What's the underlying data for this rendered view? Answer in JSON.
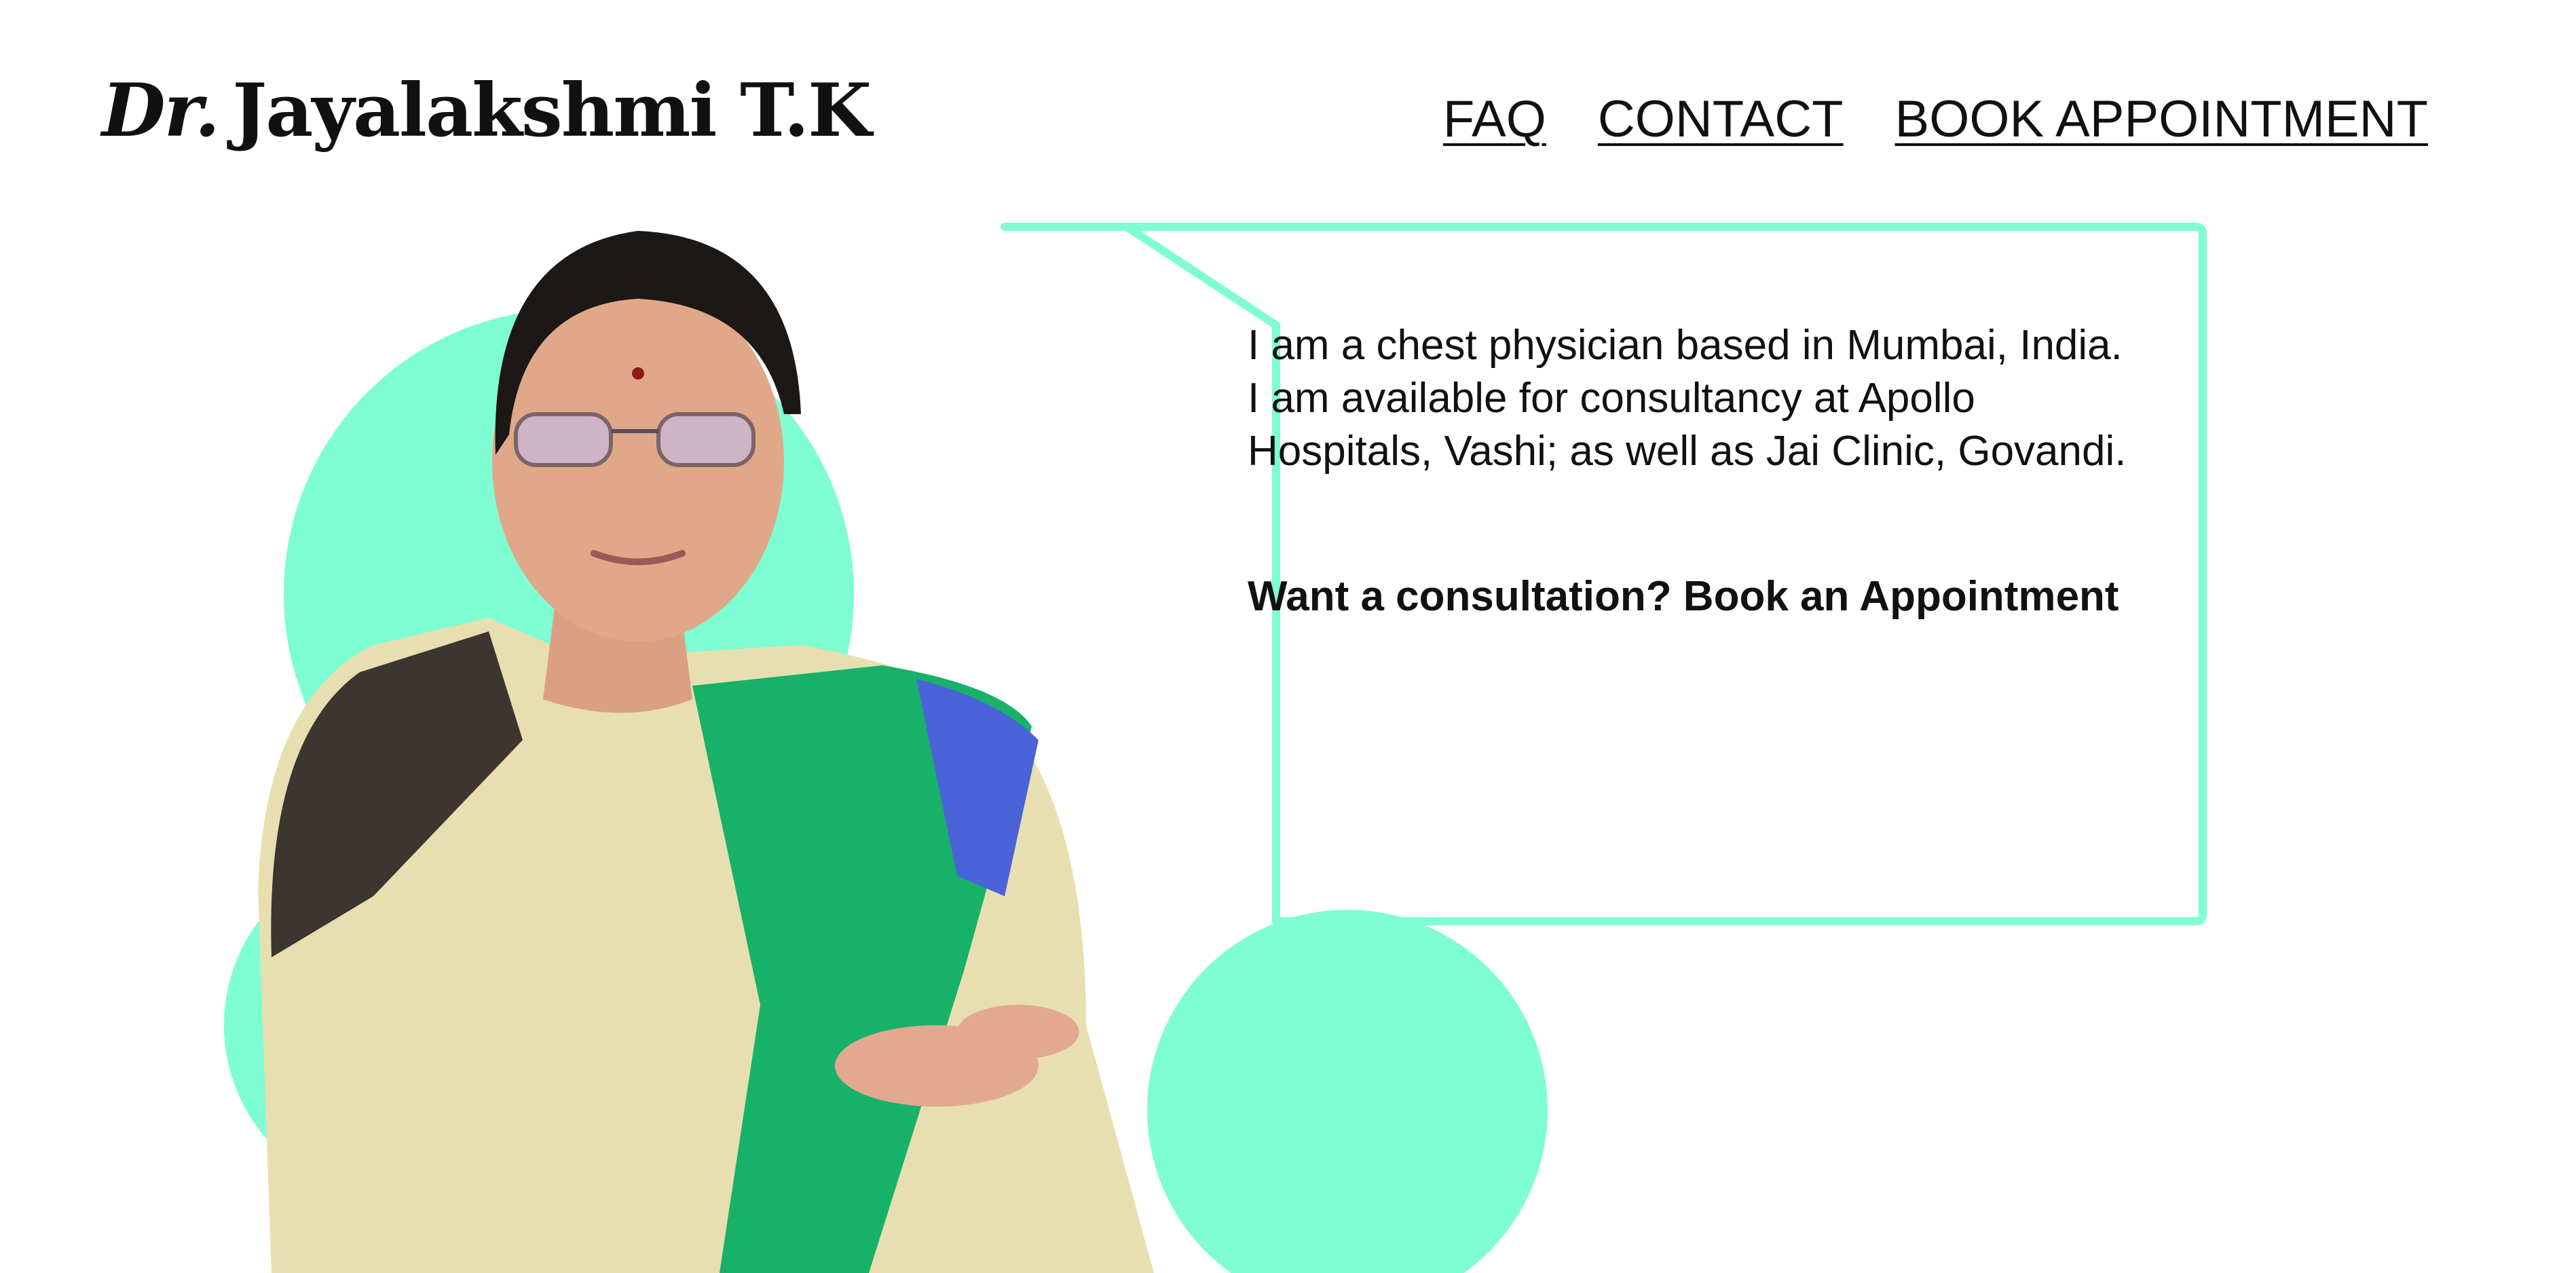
{
  "header": {
    "title_prefix": "Dr.",
    "title_name": "Jayalakshmi T.K"
  },
  "nav": {
    "items": [
      {
        "label": "FAQ"
      },
      {
        "label": "CONTACT"
      },
      {
        "label": "BOOK APPOINTMENT"
      }
    ]
  },
  "intro": {
    "bio": "I am a chest physician based in Mumbai, India. I am available for consultancy at Apollo Hospitals, Vashi; as well as Jai Clinic, Govandi.",
    "cta": "Want a consultation? Book an Appointment"
  },
  "colors": {
    "accent": "#7ffdd3",
    "text": "#111111",
    "background": "#ffffff"
  },
  "icons": {
    "photo": "doctor-portrait-icon"
  }
}
